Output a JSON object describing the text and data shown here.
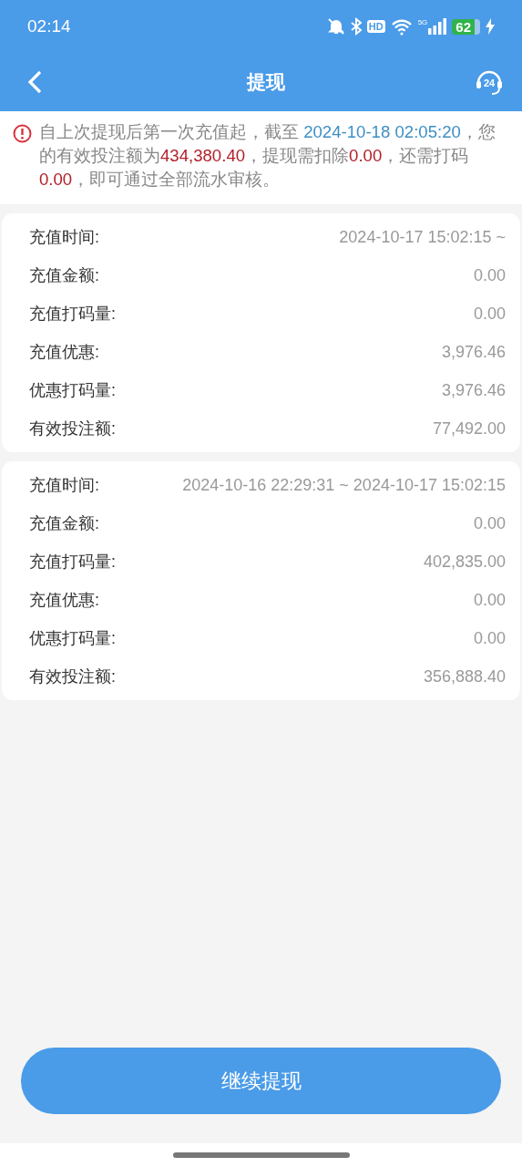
{
  "status_bar": {
    "time": "02:14",
    "hd_label": "HD",
    "network_label": "5G",
    "battery": "62"
  },
  "header": {
    "title": "提现",
    "support_label": "24"
  },
  "notice": [
    {
      "kind": "plain",
      "text": "自上次提现后第一次充值起，截至 "
    },
    {
      "kind": "date",
      "text": "2024-10-18 02:05:20"
    },
    {
      "kind": "plain",
      "text": "，您的有效投注额为"
    },
    {
      "kind": "amount",
      "text": "434,380.40"
    },
    {
      "kind": "plain",
      "text": "，提现需扣除"
    },
    {
      "kind": "amount",
      "text": "0.00"
    },
    {
      "kind": "plain",
      "text": "，还需打码"
    },
    {
      "kind": "amount",
      "text": "0.00"
    },
    {
      "kind": "plain",
      "text": "，即可通过全部流水审核。"
    }
  ],
  "records": [
    {
      "rows": [
        {
          "label": "充值时间:",
          "value": "2024-10-17 15:02:15 ~"
        },
        {
          "label": "充值金额:",
          "value": "0.00"
        },
        {
          "label": "充值打码量:",
          "value": "0.00"
        },
        {
          "label": "充值优惠:",
          "value": "3,976.46"
        },
        {
          "label": "优惠打码量:",
          "value": "3,976.46"
        },
        {
          "label": "有效投注额:",
          "value": "77,492.00"
        }
      ]
    },
    {
      "rows": [
        {
          "label": "充值时间:",
          "value": "2024-10-16 22:29:31 ~ 2024-10-17 15:02:15"
        },
        {
          "label": "充值金额:",
          "value": "0.00"
        },
        {
          "label": "充值打码量:",
          "value": "402,835.00"
        },
        {
          "label": "充值优惠:",
          "value": "0.00"
        },
        {
          "label": "优惠打码量:",
          "value": "0.00"
        },
        {
          "label": "有效投注额:",
          "value": "356,888.40"
        }
      ]
    }
  ],
  "button": "继续提现"
}
